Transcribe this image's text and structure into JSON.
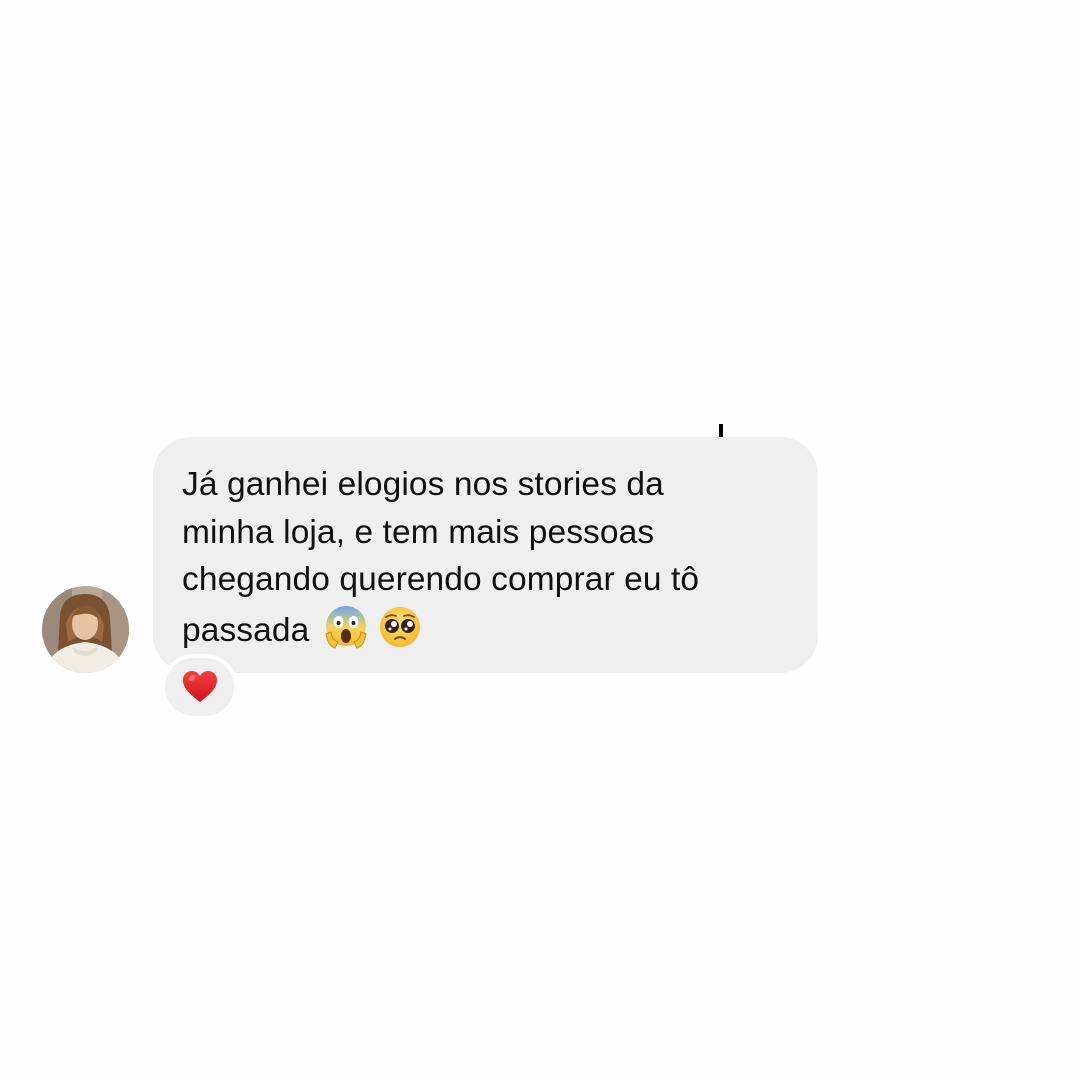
{
  "chat": {
    "message": {
      "lines": [
        "Já ganhei elogios nos stories da",
        "minha loja, e tem mais pessoas",
        "chegando querendo comprar eu tô",
        "passada"
      ],
      "emojis": [
        "face-screaming-in-fear-emoji",
        "pleading-face-emoji"
      ]
    },
    "reaction": {
      "icon": "red-heart-icon",
      "color": "#e0202a"
    },
    "avatar": {
      "icon": "user-avatar-photo"
    },
    "colors": {
      "bubble": "#efefef",
      "text": "#111111",
      "background": "#fefefe"
    }
  }
}
